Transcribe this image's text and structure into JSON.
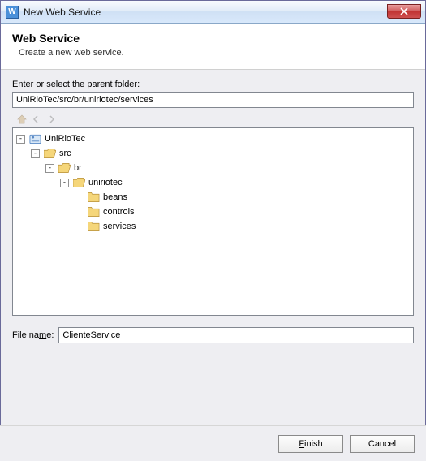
{
  "window": {
    "title": "New Web Service"
  },
  "header": {
    "title": "Web Service",
    "subtitle": "Create a new web service."
  },
  "parent": {
    "label_pre": "",
    "label_key": "E",
    "label_post": "nter or select the parent folder:",
    "value": "UniRioTec/src/br/uniriotec/services"
  },
  "tree": {
    "root": "UniRioTec",
    "src": "src",
    "br": "br",
    "uniriotec": "uniriotec",
    "beans": "beans",
    "controls": "controls",
    "services": "services"
  },
  "file": {
    "label_pre": "File na",
    "label_key": "m",
    "label_post": "e:",
    "value": "ClienteService"
  },
  "buttons": {
    "finish_pre": "",
    "finish_key": "F",
    "finish_post": "inish",
    "cancel": "Cancel"
  }
}
